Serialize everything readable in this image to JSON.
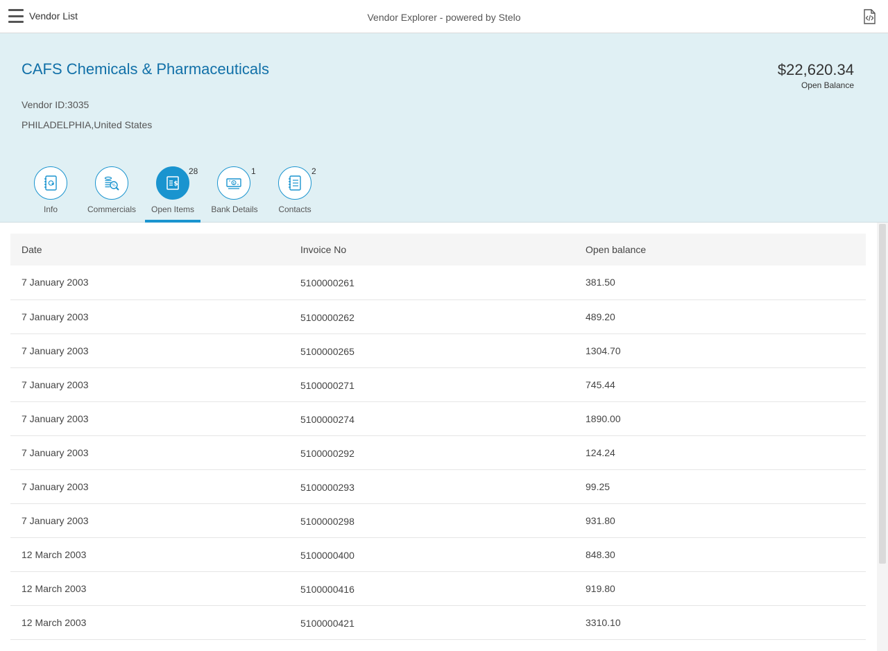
{
  "topbar": {
    "menu_label": "Vendor List",
    "app_title": "Vendor Explorer - powered by Stelo"
  },
  "vendor": {
    "name": "CAFS Chemicals & Pharmaceuticals",
    "id_text": "Vendor ID:3035",
    "location": "PHILADELPHIA,United States",
    "balance_value": "$22,620.34",
    "balance_label": "Open Balance"
  },
  "tabs": [
    {
      "label": "Info",
      "icon": "address-book-icon",
      "count": ""
    },
    {
      "label": "Commercials",
      "icon": "coins-search-icon",
      "count": ""
    },
    {
      "label": "Open Items",
      "icon": "invoice-dollar-icon",
      "count": "28",
      "active": true
    },
    {
      "label": "Bank Details",
      "icon": "banknote-icon",
      "count": "1"
    },
    {
      "label": "Contacts",
      "icon": "notebook-icon",
      "count": "2"
    }
  ],
  "table": {
    "headers": [
      "Date",
      "Invoice No",
      "Open balance"
    ],
    "rows": [
      [
        "7 January 2003",
        "5100000261",
        "381.50"
      ],
      [
        "7 January 2003",
        "5100000262",
        "489.20"
      ],
      [
        "7 January 2003",
        "5100000265",
        "1304.70"
      ],
      [
        "7 January 2003",
        "5100000271",
        "745.44"
      ],
      [
        "7 January 2003",
        "5100000274",
        "1890.00"
      ],
      [
        "7 January 2003",
        "5100000292",
        "124.24"
      ],
      [
        "7 January 2003",
        "5100000293",
        "99.25"
      ],
      [
        "7 January 2003",
        "5100000298",
        "931.80"
      ],
      [
        "12 March 2003",
        "5100000400",
        "848.30"
      ],
      [
        "12 March 2003",
        "5100000416",
        "919.80"
      ],
      [
        "12 March 2003",
        "5100000421",
        "3310.10"
      ]
    ]
  },
  "colors": {
    "accent": "#1a94cf",
    "header_bg": "#e0f0f4",
    "title_blue": "#1170a8"
  }
}
